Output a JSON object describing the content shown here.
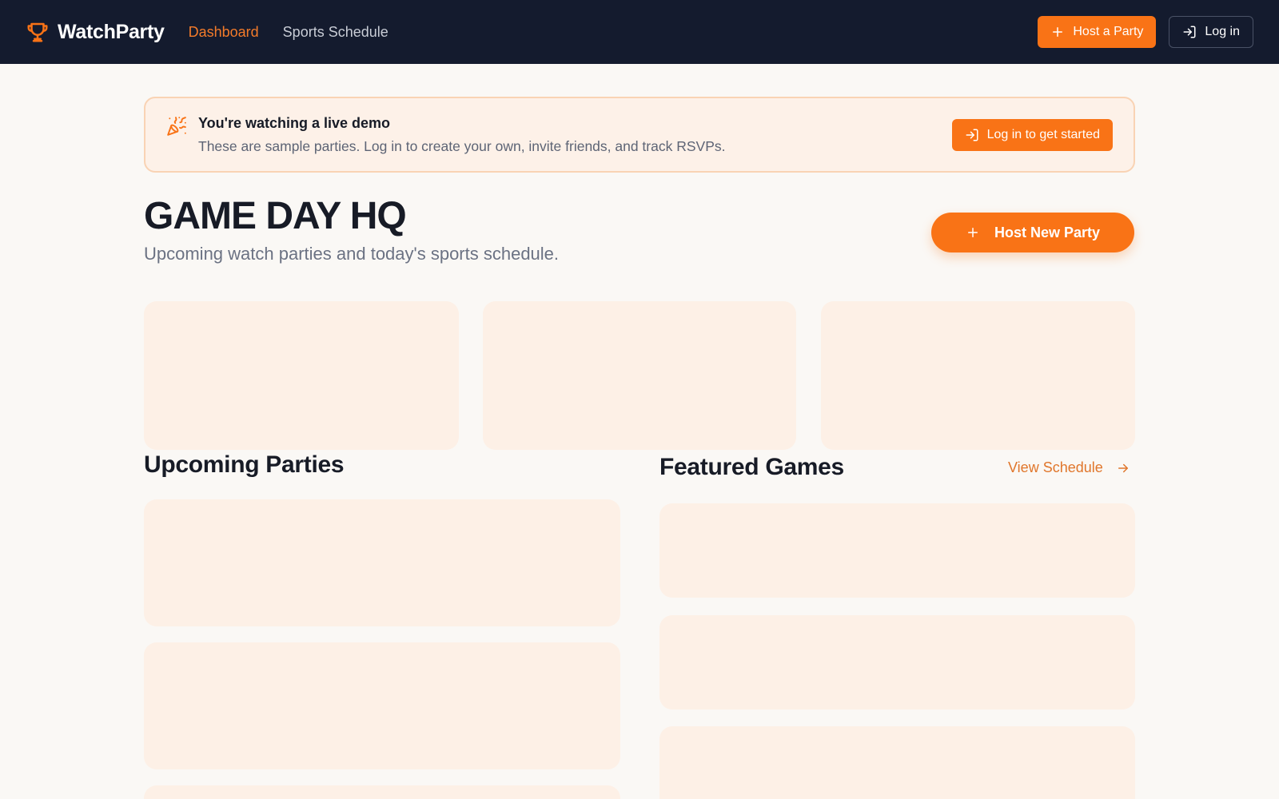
{
  "app": {
    "name": "WatchParty",
    "logo_icon": "trophy-icon"
  },
  "nav": {
    "items": [
      {
        "label": "Dashboard",
        "active": true
      },
      {
        "label": "Sports Schedule",
        "active": false
      }
    ],
    "host_button_label": "Host a Party",
    "host_button_icon": "plus-icon",
    "login_button_label": "Log in",
    "login_button_icon": "log-in-icon"
  },
  "banner": {
    "icon": "party-popper-icon",
    "title": "You're watching a live demo",
    "description": "These are sample parties. Log in to create your own, invite friends, and track RSVPs.",
    "cta_label": "Log in to get started",
    "cta_icon": "log-in-icon"
  },
  "page": {
    "title": "GAME DAY HQ",
    "subtitle": "Upcoming watch parties and today's sports schedule.",
    "host_new_label": "Host New Party",
    "host_new_icon": "plus-icon"
  },
  "sections": {
    "upcoming_title": "Upcoming Parties",
    "featured_title": "Featured Games",
    "view_schedule_label": "View Schedule",
    "view_schedule_icon": "arrow-right-icon"
  },
  "colors": {
    "accent": "#f97316",
    "nav_background": "#141b2e",
    "page_background": "#faf8f5",
    "skeleton": "#fdf0e6",
    "banner_background": "#fdf1e8",
    "banner_border": "#f9d3b4"
  }
}
